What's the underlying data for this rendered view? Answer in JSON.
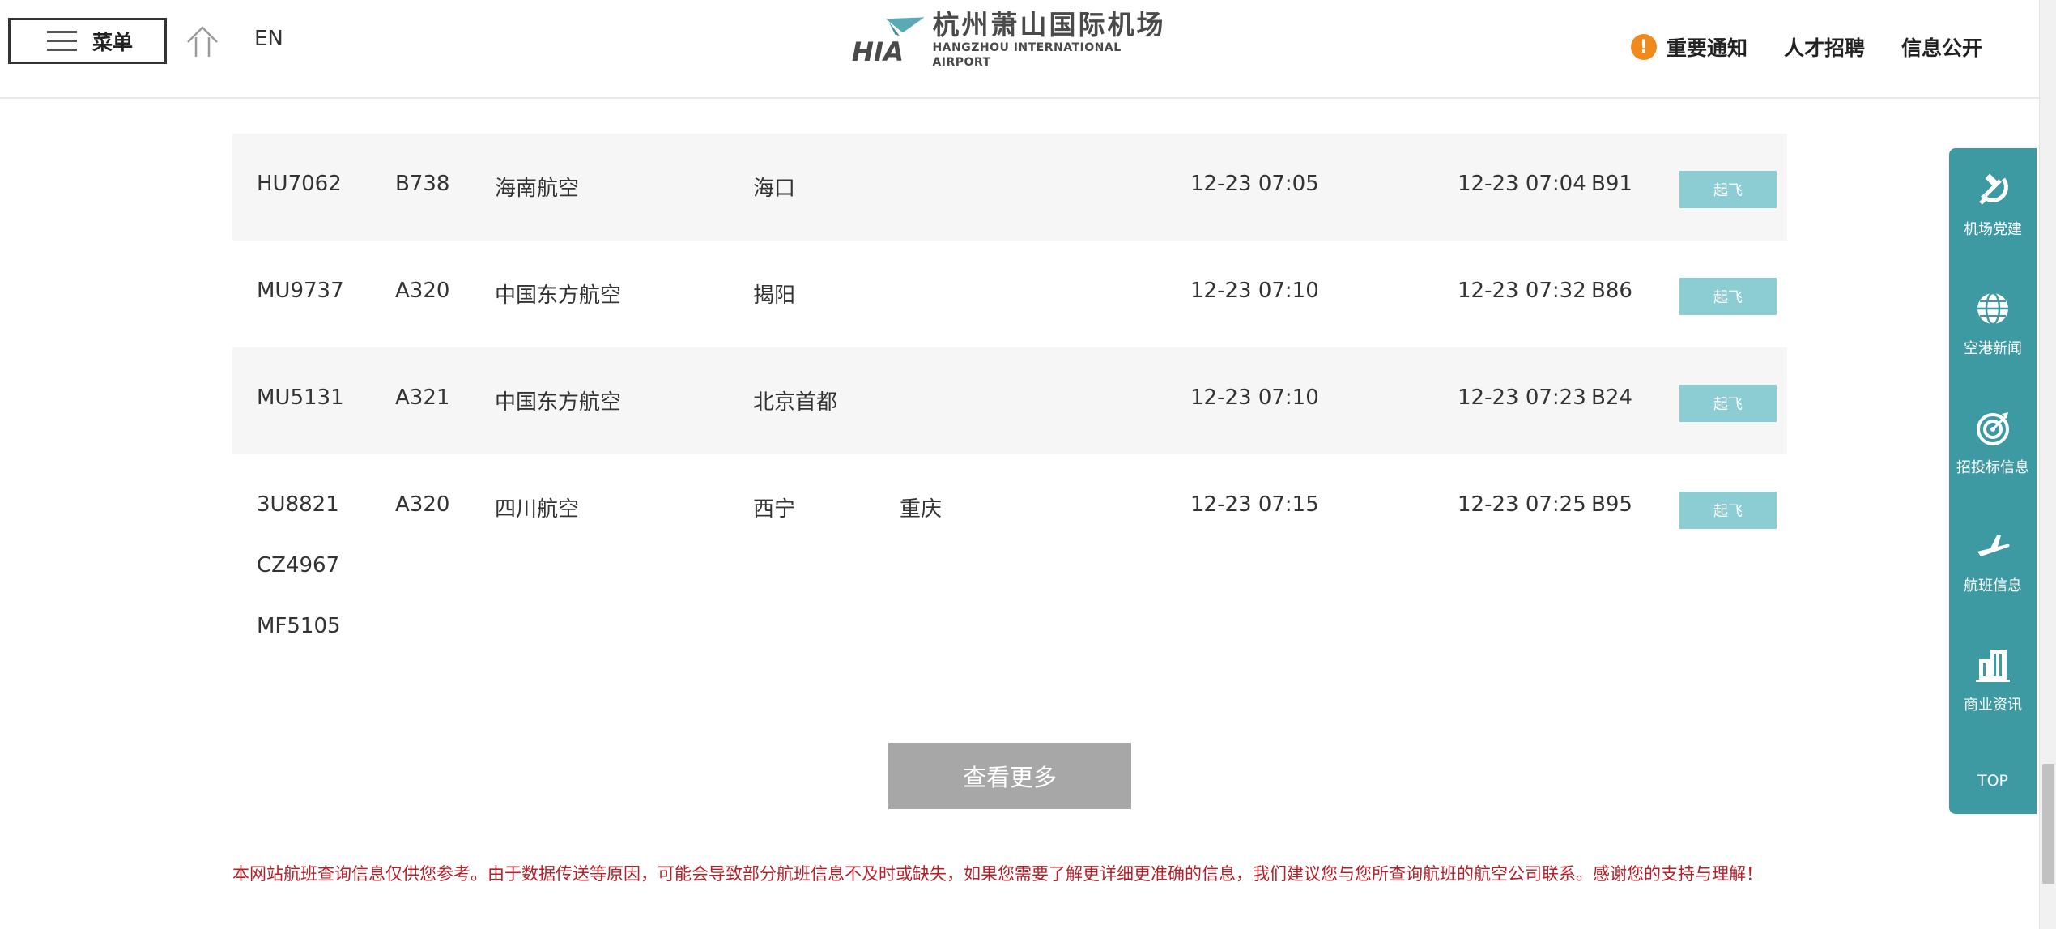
{
  "header": {
    "menu_label": "菜单",
    "lang_label": "EN",
    "logo_cn": "杭州萧山国际机场",
    "logo_en": "HANGZHOU INTERNATIONAL AIRPORT",
    "logo_mark": "HIA",
    "notice_label": "重要通知",
    "recruit_label": "人才招聘",
    "info_label": "信息公开"
  },
  "flights": [
    {
      "flight_no": "HU7062",
      "aircraft": "B738",
      "airline": "海南航空",
      "destination": "海口",
      "via": "",
      "scheduled": "12-23 07:05",
      "actual": "12-23 07:04",
      "gate": "B91",
      "status": "起飞",
      "codeshares": []
    },
    {
      "flight_no": "MU9737",
      "aircraft": "A320",
      "airline": "中国东方航空",
      "destination": "揭阳",
      "via": "",
      "scheduled": "12-23 07:10",
      "actual": "12-23 07:32",
      "gate": "B86",
      "status": "起飞",
      "codeshares": []
    },
    {
      "flight_no": "MU5131",
      "aircraft": "A321",
      "airline": "中国东方航空",
      "destination": "北京首都",
      "via": "",
      "scheduled": "12-23 07:10",
      "actual": "12-23 07:23",
      "gate": "B24",
      "status": "起飞",
      "codeshares": []
    },
    {
      "flight_no": "3U8821",
      "aircraft": "A320",
      "airline": "四川航空",
      "destination": "西宁",
      "via": "重庆",
      "scheduled": "12-23 07:15",
      "actual": "12-23 07:25",
      "gate": "B95",
      "status": "起飞",
      "codeshares": [
        "CZ4967",
        "MF5105"
      ]
    }
  ],
  "more_button": "查看更多",
  "disclaimer": "本网站航班查询信息仅供您参考。由于数据传送等原因，可能会导致部分航班信息不及时或缺失，如果您需要了解更详细更准确的信息，我们建议您与您所查询航班的航空公司联系。感谢您的支持与理解！",
  "sidebar": {
    "items": [
      {
        "label": "机场党建",
        "icon": "hammer-sickle-icon"
      },
      {
        "label": "空港新闻",
        "icon": "globe-icon"
      },
      {
        "label": "招投标信息",
        "icon": "target-icon"
      },
      {
        "label": "航班信息",
        "icon": "airplane-icon"
      },
      {
        "label": "商业资讯",
        "icon": "building-icon"
      }
    ],
    "top_label": "TOP"
  },
  "colors": {
    "sidebar_bg": "#3d9aa2",
    "status_btn": "#8bcdd3",
    "more_btn": "#a7a7a7",
    "disclaimer": "#b3202a",
    "notice_icon": "#f08a1d",
    "row_shade": "#f6f6f6"
  }
}
